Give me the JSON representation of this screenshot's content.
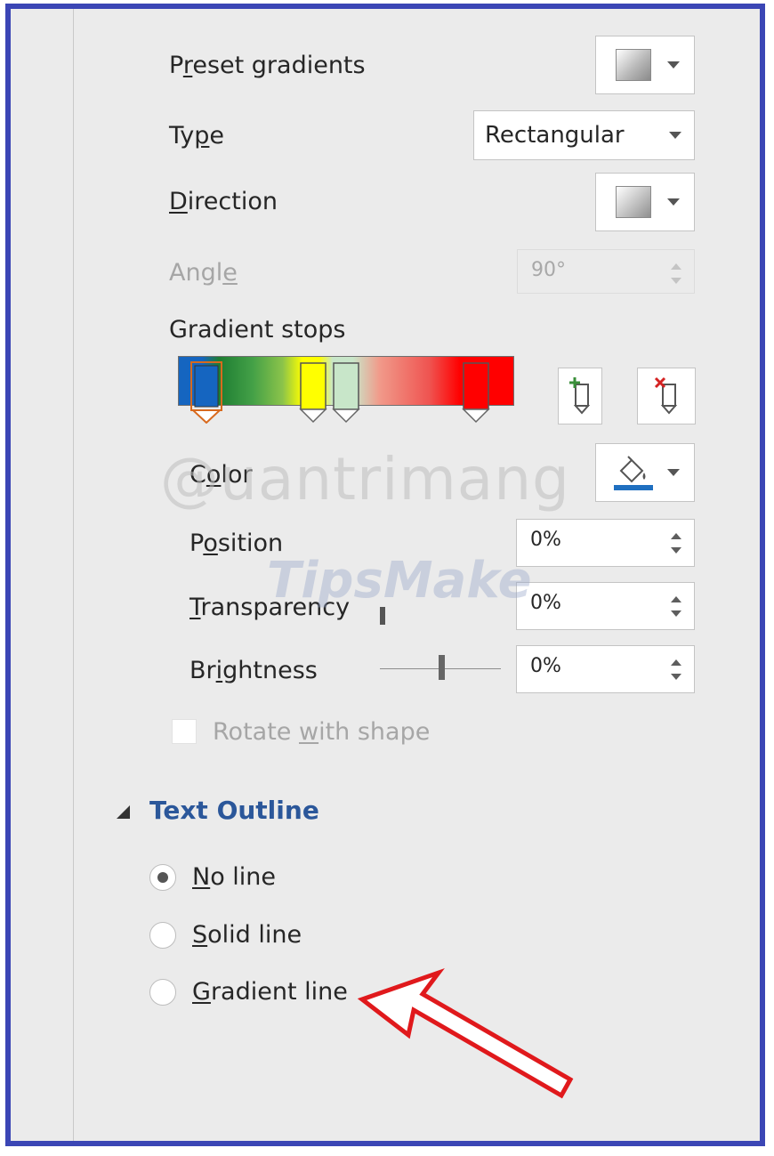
{
  "fill": {
    "preset_label_pre": "P",
    "preset_label_u": "r",
    "preset_label_post": "eset gradients",
    "type_label_pre": "Ty",
    "type_label_u": "p",
    "type_label_post": "e",
    "type_value": "Rectangular",
    "direction_label_u": "D",
    "direction_label_post": "irection",
    "angle_label_pre": "Angl",
    "angle_label_u": "e",
    "angle_value": "90°",
    "gradient_stops_label": "Gradient stops",
    "stop_colors": [
      "#1565c0",
      "#ffff00",
      "#c8e6c9",
      "#ff0000"
    ],
    "color_label_pre": "C",
    "color_label_u": "o",
    "color_label_post": "lor",
    "position_label_pre": "P",
    "position_label_u": "o",
    "position_label_post": "sition",
    "position_value": "0%",
    "transparency_label_u": "T",
    "transparency_label_post": "ransparency",
    "transparency_value": "0%",
    "brightness_label_pre": "Br",
    "brightness_label_u": "i",
    "brightness_label_post": "ghtness",
    "brightness_value": "0%",
    "brightness_slider_level": 0.5,
    "rotate_label_pre": "Rotate ",
    "rotate_label_u": "w",
    "rotate_label_post": "ith shape",
    "rotate_checked": false,
    "fill_icon_color": "#1f6fc0"
  },
  "text_outline": {
    "title": "Text Outline",
    "options": [
      {
        "u": "N",
        "rest": "o line",
        "selected": true
      },
      {
        "u": "S",
        "rest": "olid line",
        "selected": false
      },
      {
        "u": "G",
        "rest": "radient line",
        "selected": false
      }
    ]
  },
  "watermarks": {
    "primary": "@uantrimang",
    "secondary": "TipsMake"
  },
  "annotation": {
    "arrow_color": "#e0191c",
    "arrow_icon": "arrow-pointer-icon"
  }
}
